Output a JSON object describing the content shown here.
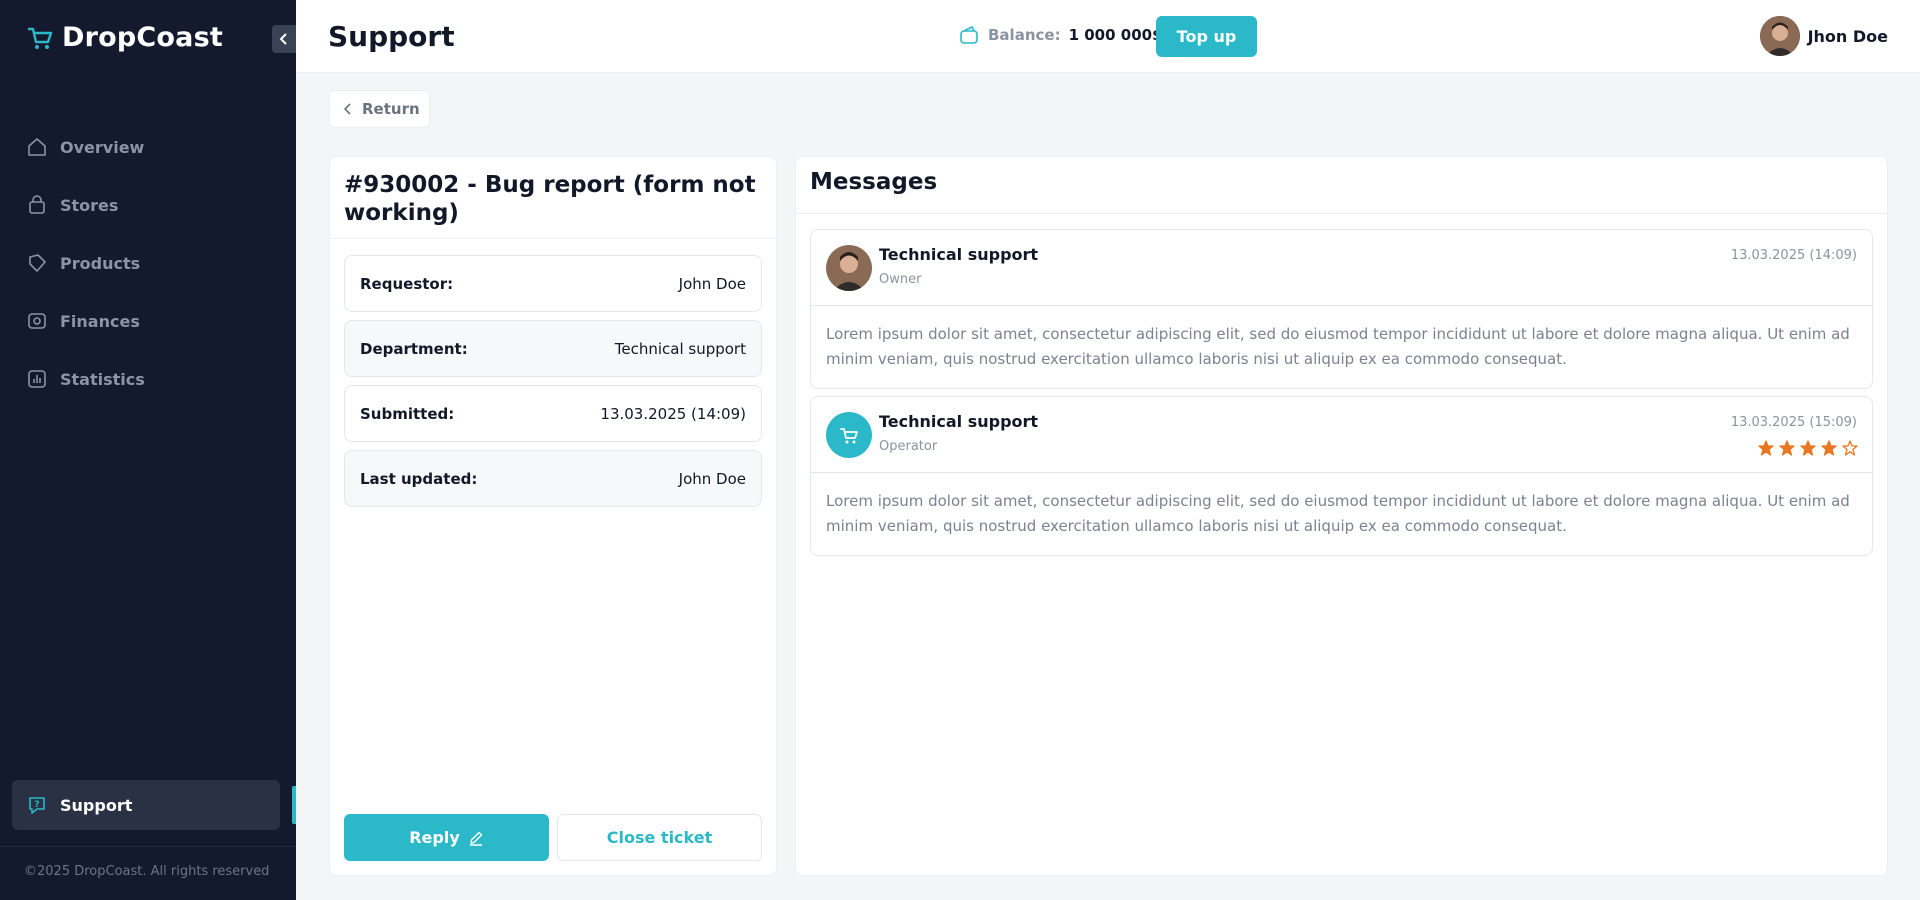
{
  "app": {
    "name": "DropCoast"
  },
  "sidebar": {
    "items": [
      {
        "label": "Overview",
        "icon": "home-icon"
      },
      {
        "label": "Stores",
        "icon": "bag-icon"
      },
      {
        "label": "Products",
        "icon": "tag-icon"
      },
      {
        "label": "Finances",
        "icon": "money-icon"
      },
      {
        "label": "Statistics",
        "icon": "chart-icon"
      }
    ],
    "support_label": "Support",
    "footer": "©2025 DropCoast. All rights reserved"
  },
  "header": {
    "title": "Support",
    "balance_label": "Balance:",
    "balance_value": "1 000 000$",
    "topup_label": "Top up",
    "user_name": "Jhon Doe"
  },
  "return_label": "Return",
  "ticket": {
    "title": "#930002 - Bug report (form not working)",
    "rows": [
      {
        "label": "Requestor:",
        "value": "John Doe"
      },
      {
        "label": "Department:",
        "value": "Technical support"
      },
      {
        "label": "Submitted:",
        "value": "13.03.2025 (14:09)"
      },
      {
        "label": "Last updated:",
        "value": "John Doe"
      }
    ],
    "reply_label": "Reply",
    "close_label": "Close ticket"
  },
  "messages": {
    "title": "Messages",
    "items": [
      {
        "author": "Technical support",
        "role": "Owner",
        "time": "13.03.2025 (14:09)",
        "body": "Lorem ipsum dolor sit amet, consectetur adipiscing elit, sed do eiusmod tempor incididunt ut labore et dolore magna aliqua. Ut enim ad minim veniam, quis nostrud exercitation ullamco laboris nisi ut aliquip ex ea commodo consequat."
      },
      {
        "author": "Technical support",
        "role": "Operator",
        "time": "13.03.2025 (15:09)",
        "rating": 4,
        "rating_max": 5,
        "body": "Lorem ipsum dolor sit amet, consectetur adipiscing elit, sed do eiusmod tempor incididunt ut labore et dolore magna aliqua. Ut enim ad minim veniam, quis nostrud exercitation ullamco laboris nisi ut aliquip ex ea commodo consequat."
      }
    ]
  },
  "colors": {
    "accent": "#2bb8c8",
    "sidebar_bg": "#141a2e",
    "star": "#e87722"
  }
}
